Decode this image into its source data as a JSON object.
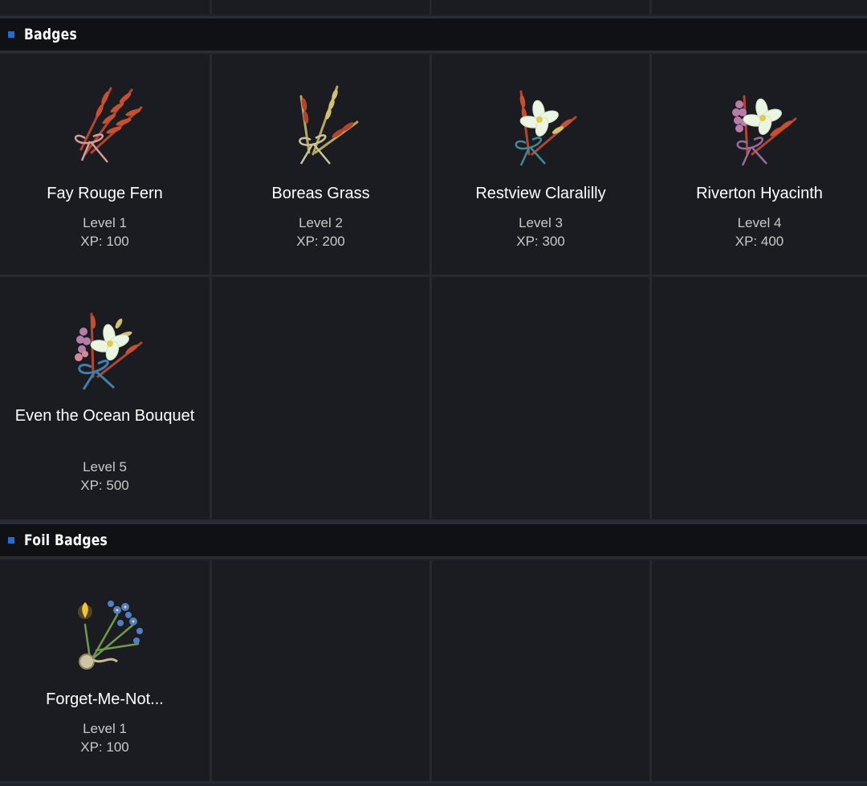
{
  "sections": [
    {
      "title": "Badges",
      "badges": [
        {
          "name": "Fay Rouge Fern",
          "level": "Level 1",
          "xp": "XP: 100",
          "icon": "fern-bouquet-icon"
        },
        {
          "name": "Boreas Grass",
          "level": "Level 2",
          "xp": "XP: 200",
          "icon": "grass-bouquet-icon"
        },
        {
          "name": "Restview Claralilly",
          "level": "Level 3",
          "xp": "XP: 300",
          "icon": "lily-bouquet-icon"
        },
        {
          "name": "Riverton Hyacinth",
          "level": "Level 4",
          "xp": "XP: 400",
          "icon": "hyacinth-bouquet-icon"
        },
        {
          "name": "Even the Ocean Bouquet",
          "level": "Level 5",
          "xp": "XP: 500",
          "icon": "ocean-bouquet-icon"
        }
      ]
    },
    {
      "title": "Foil Badges",
      "badges": [
        {
          "name": "Forget-Me-Not...",
          "level": "Level 1",
          "xp": "XP: 100",
          "icon": "forget-me-not-icon"
        }
      ]
    }
  ],
  "colors": {
    "accent": "#1f6fd1",
    "background": "#1f2229",
    "card": "#1a1c22",
    "header": "#0f1115"
  }
}
